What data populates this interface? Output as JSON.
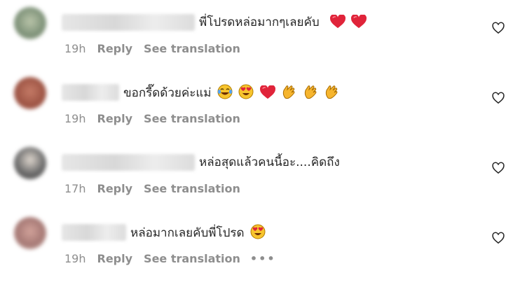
{
  "comments": [
    {
      "text": "พี่โปรดหล่อมากๆเลยคับ",
      "time": "19h",
      "reply": "Reply",
      "translate": "See translation",
      "emojis": [
        "red-heart-icon",
        "red-heart-icon"
      ]
    },
    {
      "text": "ขอกรี๊ดด้วยค่ะแม่",
      "time": "19h",
      "reply": "Reply",
      "translate": "See translation",
      "emojis": [
        "tears-of-joy-icon",
        "heart-eyes-icon",
        "red-heart-icon",
        "clapping-hands-icon",
        "clapping-hands-icon",
        "clapping-hands-icon"
      ]
    },
    {
      "text": "หล่อสุดแล้วคนนี้อะ....คิดถึง",
      "time": "17h",
      "reply": "Reply",
      "translate": "See translation",
      "emojis": []
    },
    {
      "text": "หล่อมากเลยคับพี่โปรด",
      "time": "19h",
      "reply": "Reply",
      "translate": "See translation",
      "more": "•••",
      "emojis": [
        "heart-eyes-icon"
      ]
    }
  ],
  "colors": {
    "meta": "#8e8e8e",
    "text": "#262626",
    "heart": "#ed2b3b"
  }
}
